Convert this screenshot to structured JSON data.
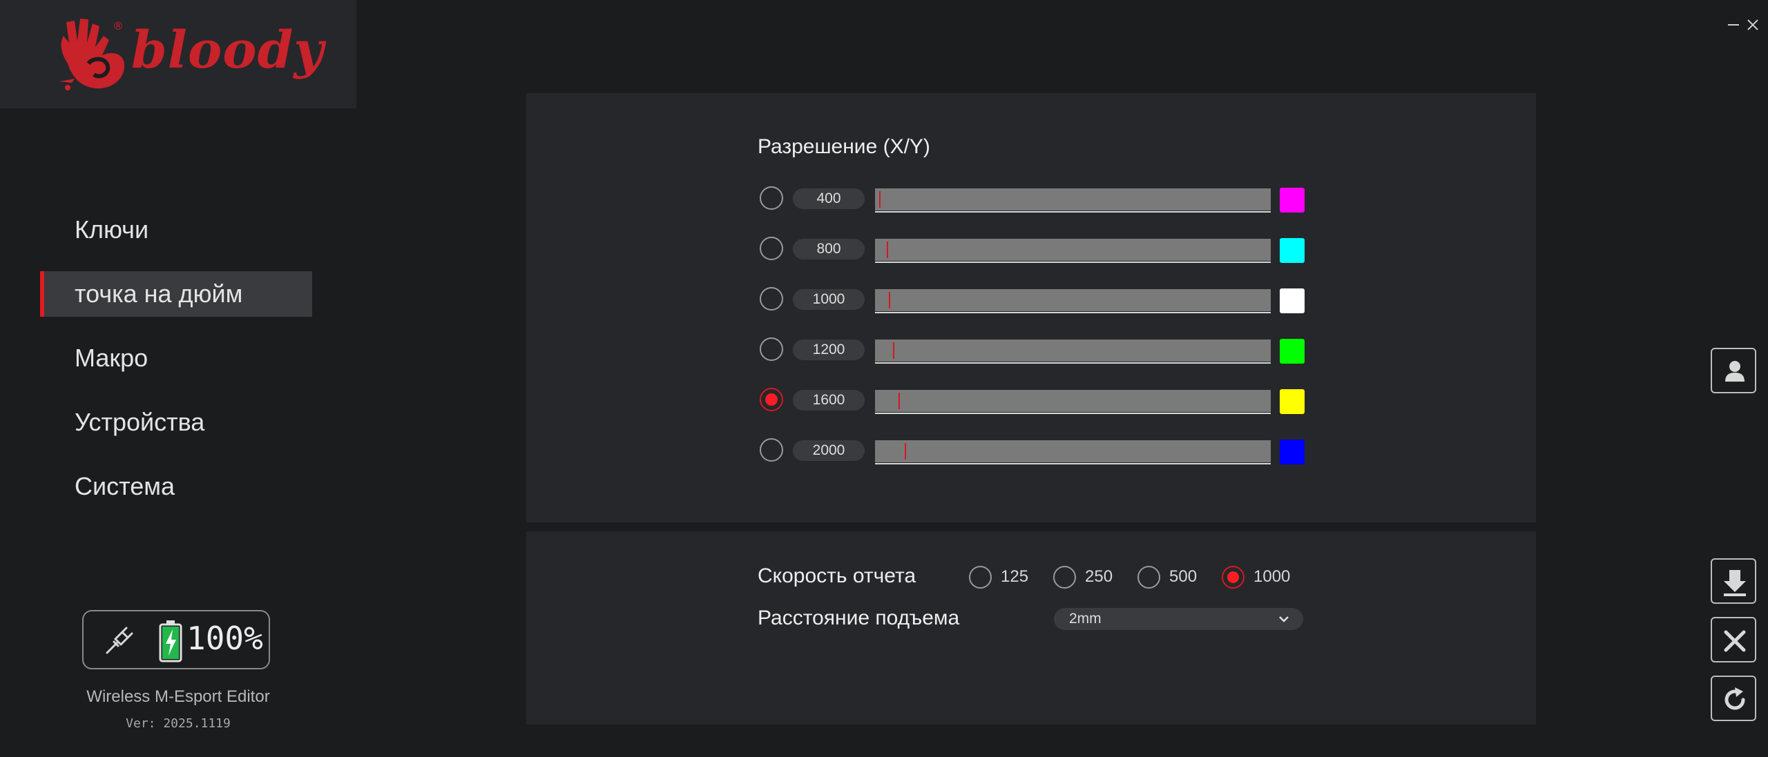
{
  "brand": {
    "name": "bloody"
  },
  "nav": {
    "items": [
      {
        "label": "Ключи"
      },
      {
        "label": "точка на дюйм",
        "active": true
      },
      {
        "label": "Макро"
      },
      {
        "label": "Устройства"
      },
      {
        "label": "Система"
      }
    ]
  },
  "status": {
    "connection_icon": "wired-plug-icon",
    "battery_icon": "battery-charging-icon",
    "battery_percent": "100%",
    "battery_level": 1.0
  },
  "app": {
    "name": "Wireless M-Esport Editor",
    "version": "Ver: 2025.1119"
  },
  "dpi": {
    "title": "Разрешение (X/Y)",
    "levels": [
      {
        "value": "400",
        "color": "#ff00ff",
        "selected": false,
        "fraction": 0.01
      },
      {
        "value": "800",
        "color": "#00ffff",
        "selected": false,
        "fraction": 0.03
      },
      {
        "value": "1000",
        "color": "#ffffff",
        "selected": false,
        "fraction": 0.035
      },
      {
        "value": "1200",
        "color": "#00ff00",
        "selected": false,
        "fraction": 0.045
      },
      {
        "value": "1600",
        "color": "#ffff00",
        "selected": true,
        "fraction": 0.06
      },
      {
        "value": "2000",
        "color": "#0000ff",
        "selected": false,
        "fraction": 0.075
      }
    ]
  },
  "report": {
    "label": "Скорость отчета",
    "options": [
      {
        "value": "125",
        "selected": false
      },
      {
        "value": "250",
        "selected": false
      },
      {
        "value": "500",
        "selected": false
      },
      {
        "value": "1000",
        "selected": true
      }
    ]
  },
  "lift": {
    "label": "Расстояние подъема",
    "value": "2mm"
  },
  "colors": {
    "accent": "#e01b22",
    "panel": "#26272a",
    "background": "#1b1c1e"
  }
}
